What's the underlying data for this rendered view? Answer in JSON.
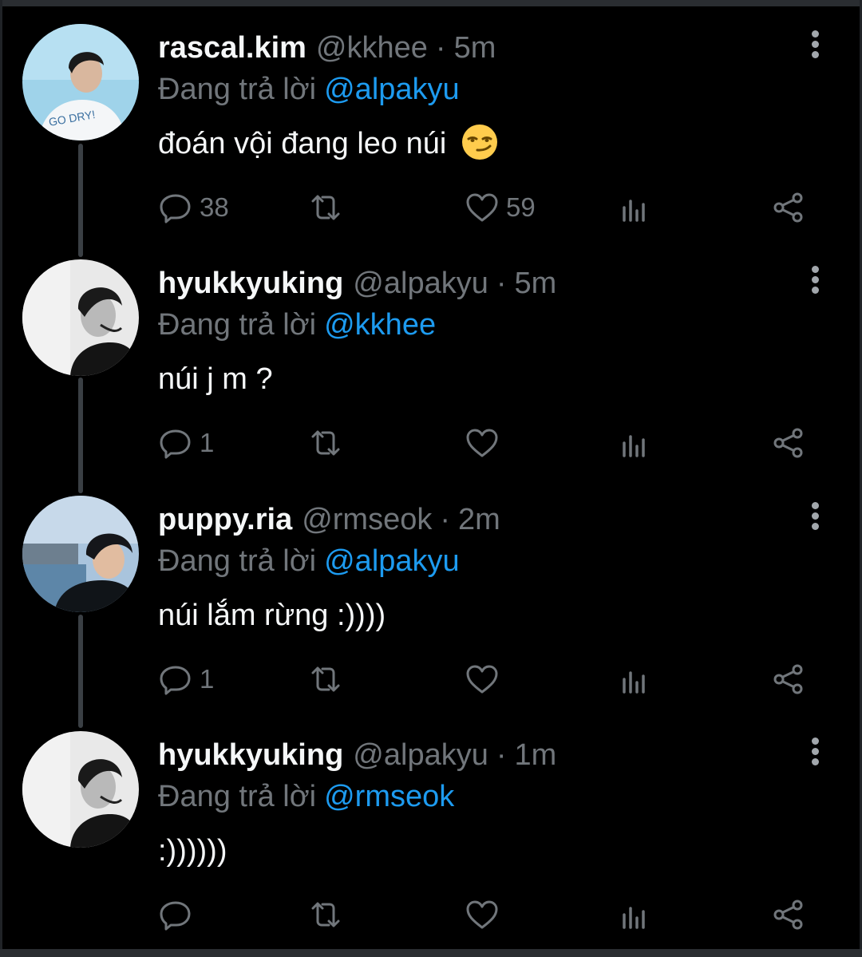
{
  "reply_prefix": "Đang trả lời",
  "tweets": [
    {
      "name": "rascal.kim",
      "handle": "@kkhee",
      "time": "5m",
      "reply_to": "@alpakyu",
      "text": "đoán vội đang leo núi",
      "emoji": "smirking-face",
      "replies": "38",
      "retweets": "",
      "likes": "59"
    },
    {
      "name": "hyukkyuking",
      "handle": "@alpakyu",
      "time": "5m",
      "reply_to": "@kkhee",
      "text": "núi j m ?",
      "replies": "1",
      "retweets": "",
      "likes": ""
    },
    {
      "name": "puppy.ria",
      "handle": "@rmseok",
      "time": "2m",
      "reply_to": "@alpakyu",
      "text": "núi lắm rừng :))))",
      "replies": "1",
      "retweets": "",
      "likes": ""
    },
    {
      "name": "hyukkyuking",
      "handle": "@alpakyu",
      "time": "1m",
      "reply_to": "@rmseok",
      "text": ":))))))",
      "replies": "",
      "retweets": "",
      "likes": ""
    }
  ],
  "colors": {
    "background": "#000000",
    "text": "#f5f7f8",
    "muted": "#71767b",
    "link": "#1d9bf0",
    "thread_line": "#3a3f44"
  },
  "separator": "·"
}
